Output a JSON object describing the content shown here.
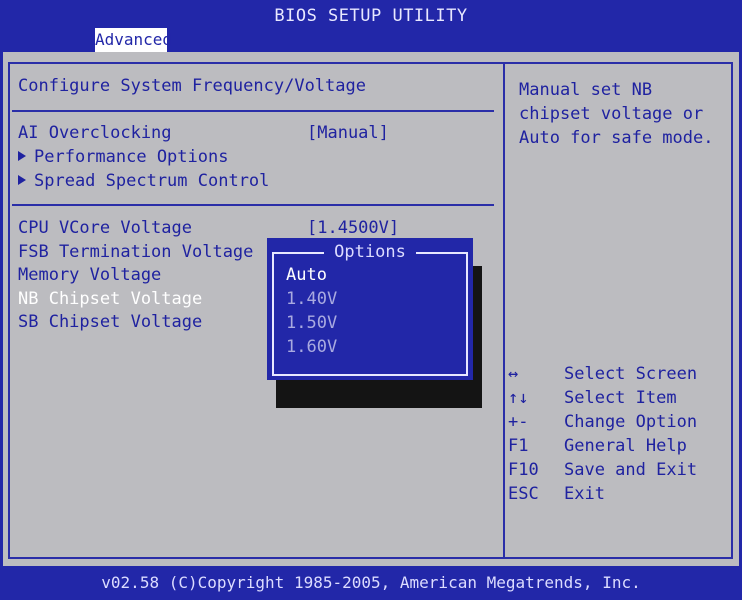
{
  "window": {
    "title": "BIOS SETUP UTILITY"
  },
  "tabs": [
    {
      "label": "Advanced",
      "active": true
    }
  ],
  "main": {
    "section_title": "Configure System Frequency/Voltage",
    "group1": [
      {
        "label": "AI Overclocking",
        "value": "[Manual]"
      },
      {
        "label": "Performance Options",
        "submenu": true
      },
      {
        "label": "Spread Spectrum Control",
        "submenu": true
      }
    ],
    "group2": [
      {
        "label": "CPU VCore Voltage",
        "value": "[1.4500V]"
      },
      {
        "label": "FSB Termination Voltage"
      },
      {
        "label": "Memory Voltage"
      },
      {
        "label": "NB Chipset Voltage",
        "selected": true
      },
      {
        "label": "SB Chipset Voltage"
      }
    ]
  },
  "popup": {
    "title": "Options",
    "options": [
      "Auto",
      "1.40V",
      "1.50V",
      "1.60V"
    ],
    "highlighted": "Auto"
  },
  "help": {
    "text": "Manual set NB chipset voltage or Auto for safe mode."
  },
  "keys": [
    {
      "key": "↔",
      "action": "Select Screen"
    },
    {
      "key": "↑↓",
      "action": "Select Item"
    },
    {
      "key": "+-",
      "action": "Change Option"
    },
    {
      "key": "F1",
      "action": "General Help"
    },
    {
      "key": "F10",
      "action": "Save and Exit"
    },
    {
      "key": "ESC",
      "action": "Exit"
    }
  ],
  "footer": {
    "text": "v02.58 (C)Copyright 1985-2005, American Megatrends, Inc."
  },
  "colors": {
    "background": "#2227a8",
    "panel": "#bcbcc0",
    "text": "#1f22a0",
    "selected_text": "#ffffff"
  }
}
